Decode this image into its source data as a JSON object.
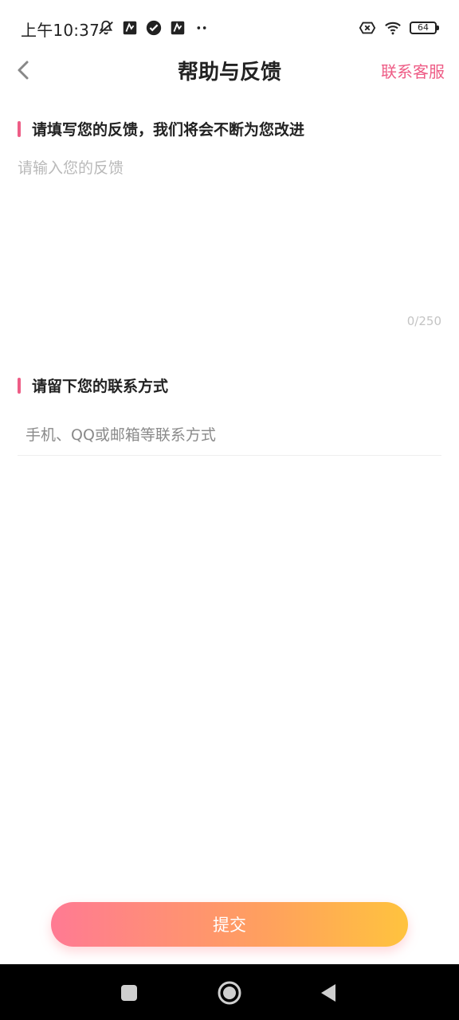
{
  "status_bar": {
    "time": "上午10:37",
    "battery": "64",
    "icons": [
      "notification-muted-icon",
      "app-notify-icon",
      "check-circle-icon",
      "app-notify-icon",
      "more-dots-icon",
      "sim-x-icon",
      "wifi-icon",
      "battery-icon"
    ]
  },
  "nav": {
    "back_icon": "chevron-left-icon",
    "title": "帮助与反馈",
    "contact_service": "联系客服"
  },
  "feedback_section": {
    "title": "请填写您的反馈，我们将会不断为您改进",
    "placeholder": "请输入您的反馈",
    "value": "",
    "char_count": "0/250"
  },
  "contact_section": {
    "title": "请留下您的联系方式",
    "placeholder": "手机、QQ或邮箱等联系方式",
    "value": ""
  },
  "submit": {
    "label": "提交"
  },
  "system_nav": {
    "icons": [
      "recent-apps-icon",
      "home-icon",
      "back-triangle-icon"
    ]
  },
  "colors": {
    "accent": "#ee5d86",
    "gradient_start": "#ff7a93",
    "gradient_end": "#ffc33e"
  }
}
